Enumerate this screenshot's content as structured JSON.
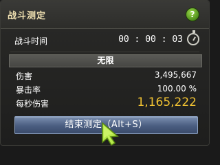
{
  "panel": {
    "title": "战斗测定",
    "help_icon": "?"
  },
  "timer": {
    "label": "战斗时间",
    "value": "00 : 00 : 03",
    "icon": "stopwatch-icon"
  },
  "mode": {
    "label": "无限"
  },
  "stats": [
    {
      "label": "伤害",
      "value": "3,495,667"
    },
    {
      "label": "暴击率",
      "value": "100.00 %"
    },
    {
      "label": "每秒伤害",
      "value": "1,165,222"
    }
  ],
  "end_button": {
    "label": "结束测定（Alt+S）"
  },
  "colors": {
    "title": "#f2e3b3",
    "dps_value": "#f1c232",
    "button": "#4a5d80",
    "help": "#6ab528",
    "cursor": "#b6e84a"
  }
}
